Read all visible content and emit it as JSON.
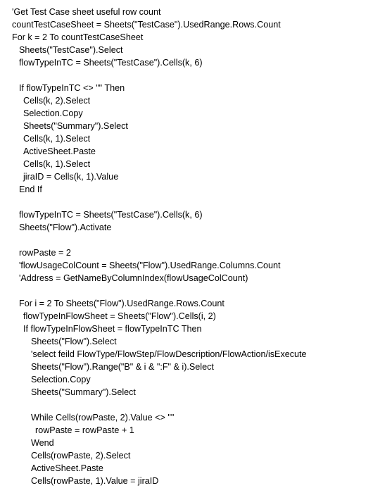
{
  "code_lines": [
    {
      "indent": 0,
      "text": "'Get Test Case sheet useful row count"
    },
    {
      "indent": 0,
      "text": "countTestCaseSheet = Sheets(\"TestCase\").UsedRange.Rows.Count"
    },
    {
      "indent": 0,
      "text": "For k = 2 To countTestCaseSheet"
    },
    {
      "indent": 1,
      "text": "Sheets(\"TestCase\").Select"
    },
    {
      "indent": 1,
      "text": "flowTypeInTC = Sheets(\"TestCase\").Cells(k, 6)"
    },
    {
      "indent": 1,
      "text": ""
    },
    {
      "indent": 1,
      "text": "If flowTypeInTC <> \"\" Then"
    },
    {
      "indent": 2,
      "text": "Cells(k, 2).Select"
    },
    {
      "indent": 2,
      "text": "Selection.Copy"
    },
    {
      "indent": 2,
      "text": "Sheets(\"Summary\").Select"
    },
    {
      "indent": 2,
      "text": "Cells(k, 1).Select"
    },
    {
      "indent": 2,
      "text": "ActiveSheet.Paste"
    },
    {
      "indent": 2,
      "text": "Cells(k, 1).Select"
    },
    {
      "indent": 2,
      "text": "jiraID = Cells(k, 1).Value"
    },
    {
      "indent": 1,
      "text": "End If"
    },
    {
      "indent": 1,
      "text": ""
    },
    {
      "indent": 1,
      "text": "flowTypeInTC = Sheets(\"TestCase\").Cells(k, 6)"
    },
    {
      "indent": 1,
      "text": "Sheets(\"Flow\").Activate"
    },
    {
      "indent": 1,
      "text": ""
    },
    {
      "indent": 1,
      "text": "rowPaste = 2"
    },
    {
      "indent": 1,
      "text": "'flowUsageColCount = Sheets(\"Flow\").UsedRange.Columns.Count"
    },
    {
      "indent": 1,
      "text": "'Address = GetNameByColumnIndex(flowUsageColCount)"
    },
    {
      "indent": 1,
      "text": ""
    },
    {
      "indent": 1,
      "text": "For i = 2 To Sheets(\"Flow\").UsedRange.Rows.Count"
    },
    {
      "indent": 2,
      "text": "flowTypeInFlowSheet = Sheets(\"Flow\").Cells(i, 2)"
    },
    {
      "indent": 2,
      "text": "If flowTypeInFlowSheet = flowTypeInTC Then"
    },
    {
      "indent": 3,
      "text": "Sheets(\"Flow\").Select"
    },
    {
      "indent": 3,
      "text": "'select feild FlowType/FlowStep/FlowDescription/FlowAction/isExecute"
    },
    {
      "indent": 3,
      "text": "Sheets(\"Flow\").Range(\"B\" & i & \":F\" & i).Select"
    },
    {
      "indent": 3,
      "text": "Selection.Copy"
    },
    {
      "indent": 3,
      "text": "Sheets(\"Summary\").Select"
    },
    {
      "indent": 3,
      "text": ""
    },
    {
      "indent": 3,
      "text": "While Cells(rowPaste, 2).Value <> \"\""
    },
    {
      "indent": 4,
      "text": "rowPaste = rowPaste + 1"
    },
    {
      "indent": 3,
      "text": "Wend"
    },
    {
      "indent": 3,
      "text": "Cells(rowPaste, 2).Select"
    },
    {
      "indent": 3,
      "text": "ActiveSheet.Paste"
    },
    {
      "indent": 3,
      "text": "Cells(rowPaste, 1).Value = jiraID"
    }
  ]
}
